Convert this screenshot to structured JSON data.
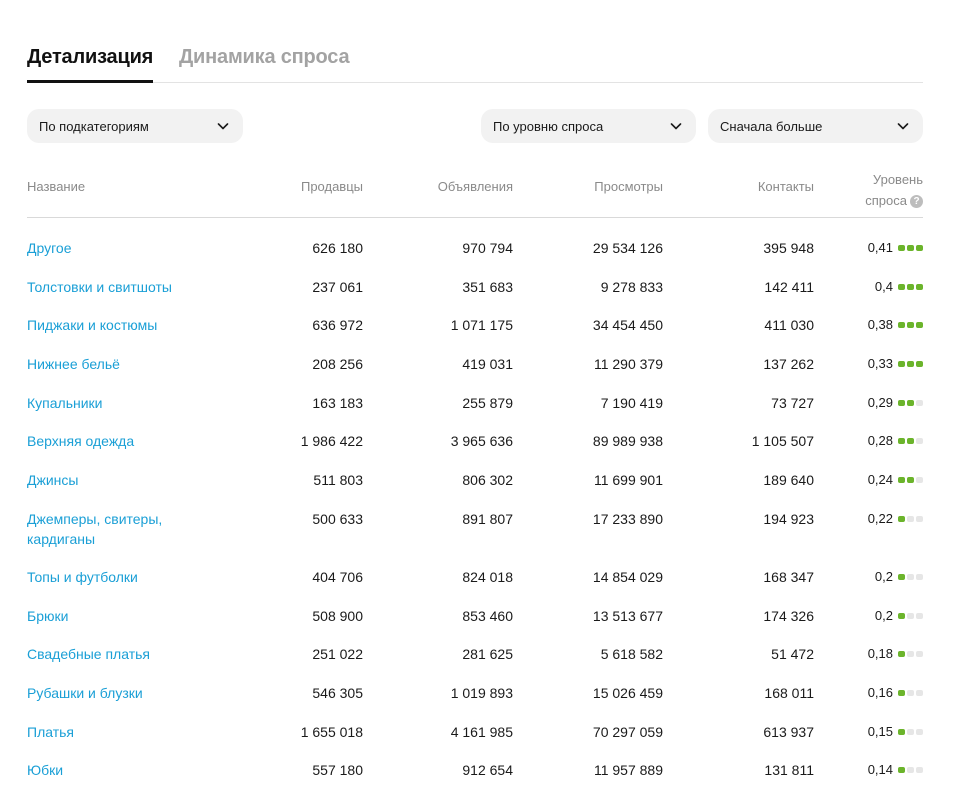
{
  "tabs": [
    {
      "label": "Детализация",
      "active": true
    },
    {
      "label": "Динамика спроса",
      "active": false
    }
  ],
  "filters": {
    "category": "По подкатегориям",
    "sort_by": "По уровню спроса",
    "order": "Сначала больше"
  },
  "table": {
    "columns": {
      "name": "Название",
      "sellers": "Продавцы",
      "ads": "Объявления",
      "views": "Просмотры",
      "contacts": "Контакты",
      "level_line1": "Уровень",
      "level_line2": "спроса"
    },
    "rows": [
      {
        "name": "Другое",
        "sellers": "626 180",
        "ads": "970 794",
        "views": "29 534 126",
        "contacts": "395 948",
        "level": "0,41",
        "bars": 3
      },
      {
        "name": "Толстовки и свитшоты",
        "sellers": "237 061",
        "ads": "351 683",
        "views": "9 278 833",
        "contacts": "142 411",
        "level": "0,4",
        "bars": 3
      },
      {
        "name": "Пиджаки и костюмы",
        "sellers": "636 972",
        "ads": "1 071 175",
        "views": "34 454 450",
        "contacts": "411 030",
        "level": "0,38",
        "bars": 3
      },
      {
        "name": "Нижнее бельё",
        "sellers": "208 256",
        "ads": "419 031",
        "views": "11 290 379",
        "contacts": "137 262",
        "level": "0,33",
        "bars": 3
      },
      {
        "name": "Купальники",
        "sellers": "163 183",
        "ads": "255 879",
        "views": "7 190 419",
        "contacts": "73 727",
        "level": "0,29",
        "bars": 2
      },
      {
        "name": "Верхняя одежда",
        "sellers": "1 986 422",
        "ads": "3 965 636",
        "views": "89 989 938",
        "contacts": "1 105 507",
        "level": "0,28",
        "bars": 2
      },
      {
        "name": "Джинсы",
        "sellers": "511 803",
        "ads": "806 302",
        "views": "11 699 901",
        "contacts": "189 640",
        "level": "0,24",
        "bars": 2
      },
      {
        "name": "Джемперы, свитеры, кардиганы",
        "sellers": "500 633",
        "ads": "891 807",
        "views": "17 233 890",
        "contacts": "194 923",
        "level": "0,22",
        "bars": 1
      },
      {
        "name": "Топы и футболки",
        "sellers": "404 706",
        "ads": "824 018",
        "views": "14 854 029",
        "contacts": "168 347",
        "level": "0,2",
        "bars": 1
      },
      {
        "name": "Брюки",
        "sellers": "508 900",
        "ads": "853 460",
        "views": "13 513 677",
        "contacts": "174 326",
        "level": "0,2",
        "bars": 1
      },
      {
        "name": "Свадебные платья",
        "sellers": "251 022",
        "ads": "281 625",
        "views": "5 618 582",
        "contacts": "51 472",
        "level": "0,18",
        "bars": 1
      },
      {
        "name": "Рубашки и блузки",
        "sellers": "546 305",
        "ads": "1 019 893",
        "views": "15 026 459",
        "contacts": "168 011",
        "level": "0,16",
        "bars": 1
      },
      {
        "name": "Платья",
        "sellers": "1 655 018",
        "ads": "4 161 985",
        "views": "70 297 059",
        "contacts": "613 937",
        "level": "0,15",
        "bars": 1
      },
      {
        "name": "Юбки",
        "sellers": "557 180",
        "ads": "912 654",
        "views": "11 957 889",
        "contacts": "131 811",
        "level": "0,14",
        "bars": 1
      }
    ]
  },
  "colors": {
    "link": "#1a9fd6",
    "bar_on": "#6bb42b",
    "bar_off": "#e6e6e6"
  },
  "icons": {
    "dropdown": "chevron-down-icon",
    "help": "question-circle-icon"
  }
}
